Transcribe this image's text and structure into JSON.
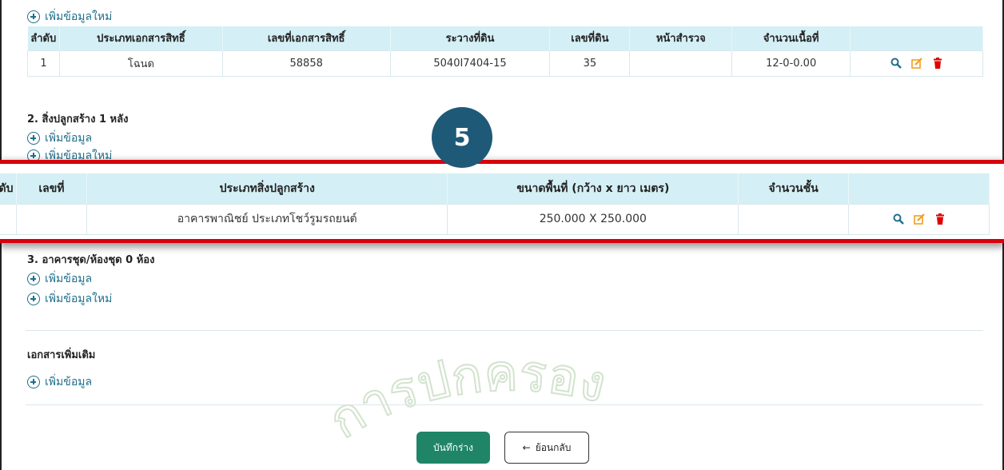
{
  "top_section": {
    "add_new_label": "เพิ่มข้อมูลใหม่",
    "table": {
      "headers": [
        "ลำดับ",
        "ประเภทเอกสารสิทธิ์",
        "เลขที่เอกสารสิทธิ์",
        "ระวางที่ดิน",
        "เลขที่ดิน",
        "หน้าสำรวจ",
        "จำนวนเนื้อที่",
        ""
      ],
      "rows": [
        [
          "1",
          "โฉนด",
          "58858",
          "5040I7404-15",
          "35",
          "",
          "12-0-0.00"
        ]
      ]
    }
  },
  "section2": {
    "title": "2. สิ่งปลูกสร้าง 1 หลัง",
    "add_label": "เพิ่มข้อมูล",
    "add_new_label": "เพิ่มข้อมูลใหม่"
  },
  "badge": {
    "number": "5"
  },
  "zoom_table": {
    "headers": [
      "ลำดับ",
      "เลขที่",
      "ประเภทสิ่งปลูกสร้าง",
      "ขนาดพื้นที่ (กว้าง x ยาว เมตร)",
      "จำนวนชั้น",
      ""
    ],
    "rows": [
      [
        "",
        "",
        "อาคารพาณิชย์ ประเภทโชว์รูมรถยนต์",
        "250.000 X 250.000",
        ""
      ]
    ]
  },
  "section3": {
    "title": "3. อาคารชุด/ห้องชุด 0 ห้อง",
    "add_label": "เพิ่มข้อมูล",
    "add_new_label": "เพิ่มข้อมูลใหม่"
  },
  "extra_docs": {
    "title": "เอกสารเพิ่มเติม",
    "add_label": "เพิ่มข้อมูล"
  },
  "buttons": {
    "save_draft": "บันทึกร่าง",
    "back": "ย้อนกลับ"
  },
  "watermark_text": "การปกครอง",
  "colors": {
    "accent": "#1f6f8b",
    "header_bg": "#d4eff5",
    "save": "#1f8566",
    "highlight": "#d8000c",
    "badge": "#1e5a78",
    "search": "#1f6f8b",
    "edit": "#f0a020",
    "delete": "#e00000"
  }
}
